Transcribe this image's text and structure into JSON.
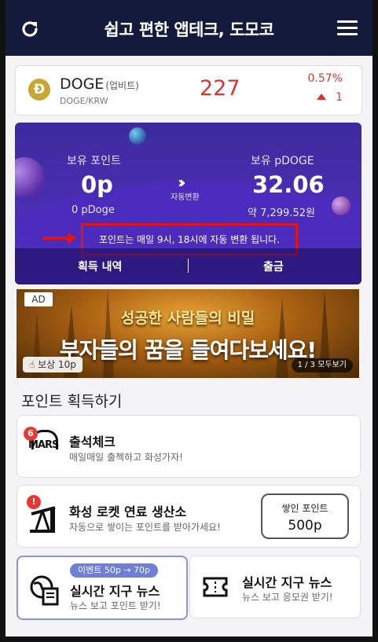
{
  "header": {
    "title": "쉽고 편한 앱테크, 도모코",
    "refresh_icon": "refresh-icon",
    "menu_icon": "hamburger-menu-icon"
  },
  "coin": {
    "symbol": "DOGE",
    "exchange": "(업비트)",
    "pair": "DOGE/KRW",
    "price": "227",
    "change_pct": "0.57%",
    "change_value": "1",
    "logo_glyph": "Ð",
    "up_color": "#d9342b"
  },
  "points": {
    "held_points_label": "보유 포인트",
    "held_points_value": "0p",
    "held_points_sub": "0 pDoge",
    "auto_convert_label": "자동변환",
    "held_pdoge_label": "보유 pDOGE",
    "held_pdoge_value": "32.06",
    "held_pdoge_sub": "약 7,299.52원",
    "notice": "포인트는 매일 9시, 18시에 자동 변환 됩니다.",
    "history_label": "획득 내역",
    "withdraw_label": "출금"
  },
  "ad": {
    "badge": "AD",
    "headline": "성공한 사람들의 비밀",
    "main": "부자들의 꿈을 들여다보세요!",
    "reward": "보상 10p",
    "pager": "1 / 3 모두보기"
  },
  "earn": {
    "section_title": "포인트 획득하기",
    "attendance": {
      "badge": "6",
      "logo_text": "MARS",
      "title": "출석체크",
      "desc": "매일매일 출첵하고 화성가자!"
    },
    "rocket_fuel": {
      "badge": "!",
      "title": "화성 로켓 연료 생산소",
      "desc": "자동으로 쌓이는 포인트를 받아가세요!",
      "stacked_label": "쌓인 포인트",
      "stacked_value": "500p"
    },
    "news_points": {
      "event_tag": "이벤트 50p → 70p",
      "title": "실시간 지구 뉴스",
      "desc": "뉴스 보고 포인트 받기!"
    },
    "news_coupon": {
      "title": "실시간 지구 뉴스",
      "desc": "뉴스 보고 응모권 받기!"
    }
  }
}
